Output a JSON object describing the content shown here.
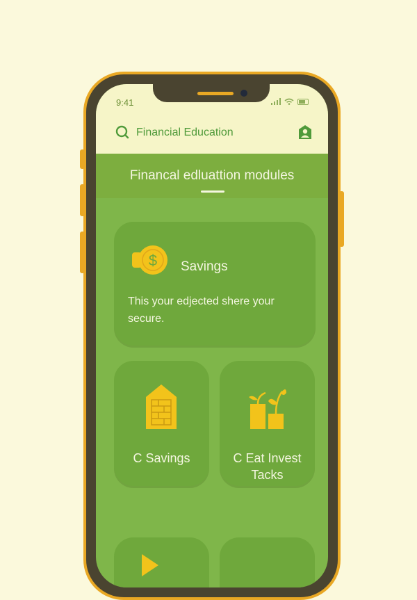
{
  "status_bar": {
    "time": "9:41"
  },
  "header": {
    "title": "Financial Education"
  },
  "banner": {
    "title": "Financal edluattion modules"
  },
  "cards": {
    "savings": {
      "title": "Savings",
      "description": "This your edjected shere your secure."
    },
    "left": {
      "label": "C Savings"
    },
    "right": {
      "label": "C Eat Invest Tacks"
    }
  },
  "colors": {
    "accent": "#e9a824",
    "icon_yellow": "#f2c31b",
    "card_green": "#6fa83c",
    "banner_green": "#7dae3f",
    "header_bg": "#f6f5c8"
  },
  "icons": {
    "header": "search-icon",
    "profile": "profile-icon",
    "savings": "coin-icon",
    "left_card": "house-brick-icon",
    "right_card": "plant-growth-icon"
  }
}
